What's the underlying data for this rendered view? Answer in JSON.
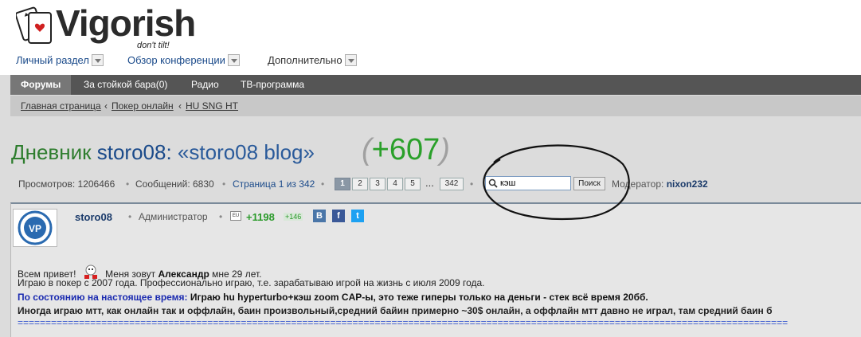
{
  "logo": {
    "text": "Vigorish",
    "tagline": "don't tilt!"
  },
  "topnav": [
    {
      "label": "Личный раздел"
    },
    {
      "label": "Обзор конференции"
    },
    {
      "label": "Дополнительно"
    }
  ],
  "mainbar": [
    {
      "label": "Форумы",
      "active": true
    },
    {
      "label": "За стойкой бара(0)"
    },
    {
      "label": "Радио"
    },
    {
      "label": "ТВ-программа"
    }
  ],
  "breadcrumb": [
    {
      "label": "Главная страница"
    },
    {
      "label": "Покер онлайн"
    },
    {
      "label": "HU SNG HT"
    }
  ],
  "breadcrumb_sep": "‹",
  "title": {
    "prefix": "Дневник",
    "user": "storo08:",
    "blog": "«storo08 blog»",
    "score": "+607",
    "paren_open": "(",
    "paren_close": ")"
  },
  "stats": {
    "views": "Просмотров: 1206466",
    "messages": "Сообщений: 6830",
    "page": "Страница 1 из 342",
    "pages": [
      "1",
      "2",
      "3",
      "4",
      "5"
    ],
    "ellipsis": "...",
    "last_page": "342",
    "dot": "•"
  },
  "search": {
    "value": "кэш",
    "button": "Поиск"
  },
  "moderator": {
    "label": "Модератор:",
    "name": "nixon232"
  },
  "post": {
    "author": "storo08",
    "role": "Администратор",
    "flag": "EU",
    "karma": "+1198",
    "karma_small": "+146",
    "social": [
      "B",
      "f",
      "t"
    ],
    "greeting": "Всем привет!",
    "intro_1": "Меня зовут",
    "name": "Александр",
    "intro_2": "мне 29 лет.",
    "line2": "Играю в покер с 2007 года. Профессионально играю, т.е. зарабатываю игрой на жизнь с июля 2009 года.",
    "line3_label": "По состоянию на настоящее время:",
    "line3_text": "Играю hu hyperturbo+кэш zoom CAP-ы, это теже гиперы только на деньги - стек всё время 20бб.",
    "line4": "Иногда играю мтт, как онлайн так и оффлайн, баин произвольный,средний байин примерно ~30$ онлайн, а оффлайн мтт давно не играл, там средний баин б",
    "separator": "=========================================================================================================================================="
  },
  "colors": {
    "accent_green": "#2aa02a",
    "link_blue": "#1a4a8a",
    "nav_dark": "#555555"
  }
}
